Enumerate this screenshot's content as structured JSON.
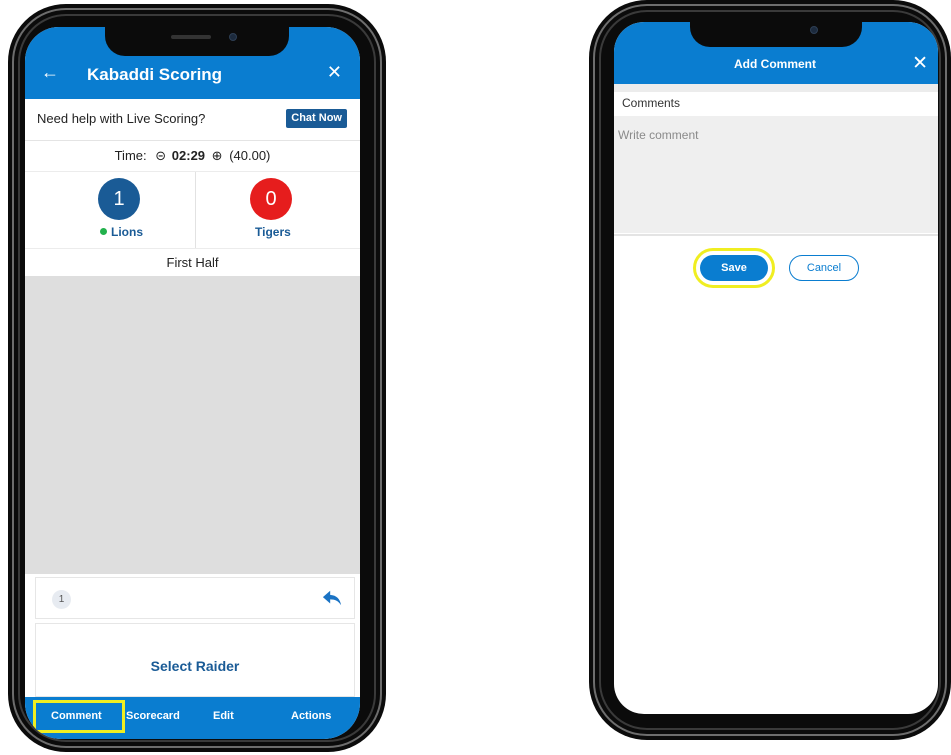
{
  "scoring_screen": {
    "header": {
      "back_icon": "arrow-left-icon",
      "title": "Kabaddi Scoring",
      "close_icon": "close-icon"
    },
    "help": {
      "text": "Need help with Live Scoring?",
      "chat_button": "Chat Now"
    },
    "timer": {
      "label": "Time:",
      "minus_icon": "minus-circle-icon",
      "time": "02:29",
      "plus_icon": "plus-circle-icon",
      "duration": "(40.00)"
    },
    "teams": [
      {
        "name": "Lions",
        "score": "1",
        "color": "#1a5b96",
        "active": true
      },
      {
        "name": "Tigers",
        "score": "0",
        "color": "#e61d1d",
        "active": false
      }
    ],
    "period": "First Half",
    "over_badge": "1",
    "undo_icon": "undo-icon",
    "raider_prompt": "Select Raider",
    "bottom_nav": [
      "Comment",
      "Scorecard",
      "Edit",
      "Actions"
    ],
    "highlighted_nav": "Comment"
  },
  "comment_screen": {
    "header": {
      "title": "Add Comment",
      "close_icon": "close-icon"
    },
    "comments_label": "Comments",
    "comment_placeholder": "Write comment",
    "save_button": "Save",
    "cancel_button": "Cancel",
    "highlighted_button": "Save"
  },
  "colors": {
    "primary": "#0a7dd0",
    "navy": "#1a5b96",
    "red": "#e61d1d",
    "highlight": "#f0ee21",
    "active_dot": "#22b14c"
  }
}
